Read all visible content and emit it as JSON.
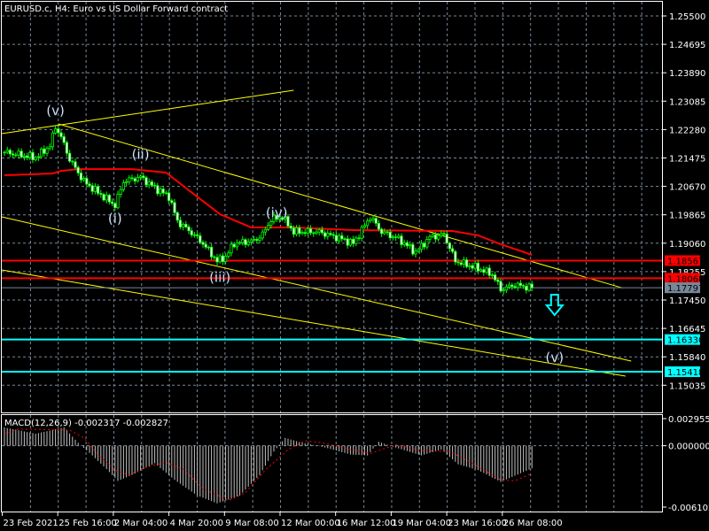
{
  "header": {
    "title": "EURUSD.c, H4:  Euro vs US Dollar Forward contract"
  },
  "colors": {
    "background": "#000000",
    "bull": "#00ff00",
    "ma": "#ff0000",
    "trend": "#ffff00",
    "level_red": "#ff0000",
    "level_cyan": "#00ffff",
    "bid": "#778899",
    "histogram": "#c0c0c0",
    "signal": "#ff0000",
    "grid": "#778899"
  },
  "chart_data": [
    {
      "type": "candlestick",
      "title": "EURUSD.c, H4:  Euro vs US Dollar Forward contract",
      "symbol": "EURUSD.c",
      "timeframe": "H4",
      "ylim": [
        1.15035,
        1.255
      ],
      "y_ticks": [
        "1.25500",
        "1.24695",
        "1.23890",
        "1.23085",
        "1.22280",
        "1.21475",
        "1.20670",
        "1.19865",
        "1.19060",
        "1.18255",
        "1.17450",
        "1.16645",
        "1.15840",
        "1.15035"
      ],
      "x_ticks": [
        "23 Feb 2021",
        "25 Feb 16:00",
        "2 Mar 04:00",
        "4 Mar 20:00",
        "9 Mar 08:00",
        "12 Mar 00:00",
        "16 Mar 12:00",
        "19 Mar 04:00",
        "23 Mar 16:00",
        "26 Mar 08:00"
      ],
      "bar_count": 187,
      "close_path": [
        [
          0,
          1.21638
        ],
        [
          11,
          1.21487
        ],
        [
          16,
          1.21813
        ],
        [
          18,
          1.22365
        ],
        [
          20,
          1.22064
        ],
        [
          23,
          1.21437
        ],
        [
          28,
          1.2081
        ],
        [
          34,
          1.20434
        ],
        [
          39,
          1.20133
        ],
        [
          42,
          1.2081
        ],
        [
          48,
          1.20935
        ],
        [
          53,
          1.20634
        ],
        [
          58,
          1.20384
        ],
        [
          61,
          1.19681
        ],
        [
          66,
          1.19355
        ],
        [
          70,
          1.19054
        ],
        [
          75,
          1.18553
        ],
        [
          78,
          1.18678
        ],
        [
          81,
          1.19054
        ],
        [
          88,
          1.1913
        ],
        [
          91,
          1.19305
        ],
        [
          94,
          1.19732
        ],
        [
          98,
          1.19807
        ],
        [
          102,
          1.1938
        ],
        [
          111,
          1.1938
        ],
        [
          119,
          1.1918
        ],
        [
          123,
          1.19054
        ],
        [
          129,
          1.19807
        ],
        [
          133,
          1.1938
        ],
        [
          139,
          1.1918
        ],
        [
          145,
          1.18804
        ],
        [
          150,
          1.1923
        ],
        [
          155,
          1.19305
        ],
        [
          159,
          1.18553
        ],
        [
          166,
          1.18377
        ],
        [
          172,
          1.18177
        ],
        [
          175,
          1.1775
        ],
        [
          180,
          1.17876
        ],
        [
          186,
          1.17797
        ]
      ],
      "moving_average": [
        [
          0,
          1.20985
        ],
        [
          17,
          1.21035
        ],
        [
          20,
          1.2111
        ],
        [
          26,
          1.2116
        ],
        [
          45,
          1.2116
        ],
        [
          57,
          1.2106
        ],
        [
          63,
          1.20684
        ],
        [
          76,
          1.19882
        ],
        [
          87,
          1.19506
        ],
        [
          102,
          1.19506
        ],
        [
          123,
          1.19431
        ],
        [
          158,
          1.19406
        ],
        [
          167,
          1.19281
        ],
        [
          175,
          1.1903
        ],
        [
          186,
          1.1873
        ]
      ],
      "levels": [
        {
          "price": "1.18567",
          "color": "#ff0000"
        },
        {
          "price": "1.18068",
          "color": "#ff0000"
        },
        {
          "price": "1.17797",
          "color": "#778899"
        },
        {
          "price": "1.16330",
          "color": "#00ffff"
        },
        {
          "price": "1.15418",
          "color": "#00ffff"
        }
      ],
      "trendlines": [
        [
          [
            -1,
            1.22164
          ],
          [
            102,
            1.23393
          ]
        ],
        [
          [
            19,
            1.2244
          ],
          [
            218,
            1.1779
          ]
        ],
        [
          [
            -1,
            1.19807
          ],
          [
            221,
            1.15719
          ]
        ],
        [
          [
            -1,
            1.18302
          ],
          [
            219,
            1.15293
          ]
        ]
      ],
      "wave_labels": [
        {
          "text": "(v)",
          "bar": 18,
          "price": 1.2269
        },
        {
          "text": "(ii)",
          "bar": 48,
          "price": 1.2145
        },
        {
          "text": "(i)",
          "bar": 39,
          "price": 1.1963
        },
        {
          "text": "(iii)",
          "bar": 76,
          "price": 1.1796
        },
        {
          "text": "(iv)",
          "bar": 96,
          "price": 1.198
        },
        {
          "text": "(v)",
          "bar": 194,
          "price": 1.157
        }
      ],
      "arrow": {
        "direction": "down",
        "bar": 194,
        "price": 1.1705
      }
    },
    {
      "type": "macd",
      "label": "MACD(12,26,9) -0.002317 -0.002827",
      "params": "12,26,9",
      "main_value": -0.002317,
      "signal_value": -0.002827,
      "ylim": [
        -0.006102,
        0.002955
      ],
      "y_ticks": [
        "0.002955",
        "0.000000",
        "-0.006102"
      ],
      "histogram_path": [
        [
          0,
          0.00187
        ],
        [
          11,
          0.00123
        ],
        [
          21,
          0.00187
        ],
        [
          26,
          0.0003
        ],
        [
          31,
          -0.001
        ],
        [
          36,
          -0.0024
        ],
        [
          40,
          -0.0036
        ],
        [
          45,
          -0.003
        ],
        [
          53,
          -0.0018
        ],
        [
          60,
          -0.0035
        ],
        [
          68,
          -0.0051
        ],
        [
          75,
          -0.0059
        ],
        [
          83,
          -0.0051
        ],
        [
          90,
          -0.003
        ],
        [
          95,
          -0.0006
        ],
        [
          99,
          0.0008
        ],
        [
          105,
          0.0003
        ],
        [
          112,
          -0.0001
        ],
        [
          122,
          -0.0009
        ],
        [
          128,
          -0.001
        ],
        [
          132,
          0.0004
        ],
        [
          137,
          -0.0001
        ],
        [
          147,
          -0.001
        ],
        [
          154,
          -0.0004
        ],
        [
          160,
          -0.0019
        ],
        [
          167,
          -0.0025
        ],
        [
          175,
          -0.0037
        ],
        [
          186,
          -0.002317
        ]
      ],
      "signal_path": [
        [
          0,
          0.0012
        ],
        [
          5,
          0.0017
        ],
        [
          23,
          0.0016
        ],
        [
          28,
          0.0008
        ],
        [
          33,
          -0.0009
        ],
        [
          39,
          -0.0025
        ],
        [
          44,
          -0.003
        ],
        [
          50,
          -0.0022
        ],
        [
          57,
          -0.0017
        ],
        [
          63,
          -0.0024
        ],
        [
          70,
          -0.0044
        ],
        [
          79,
          -0.0056
        ],
        [
          85,
          -0.0048
        ],
        [
          92,
          -0.0025
        ],
        [
          100,
          -0.0004
        ],
        [
          106,
          0.0005
        ],
        [
          112,
          0.0003
        ],
        [
          121,
          -0.0003
        ],
        [
          129,
          -0.0008
        ],
        [
          138,
          0.0001
        ],
        [
          147,
          -0.0005
        ],
        [
          157,
          -0.0006
        ],
        [
          165,
          -0.0018
        ],
        [
          175,
          -0.0035
        ],
        [
          180,
          -0.0036
        ],
        [
          186,
          -0.002827
        ]
      ]
    }
  ]
}
